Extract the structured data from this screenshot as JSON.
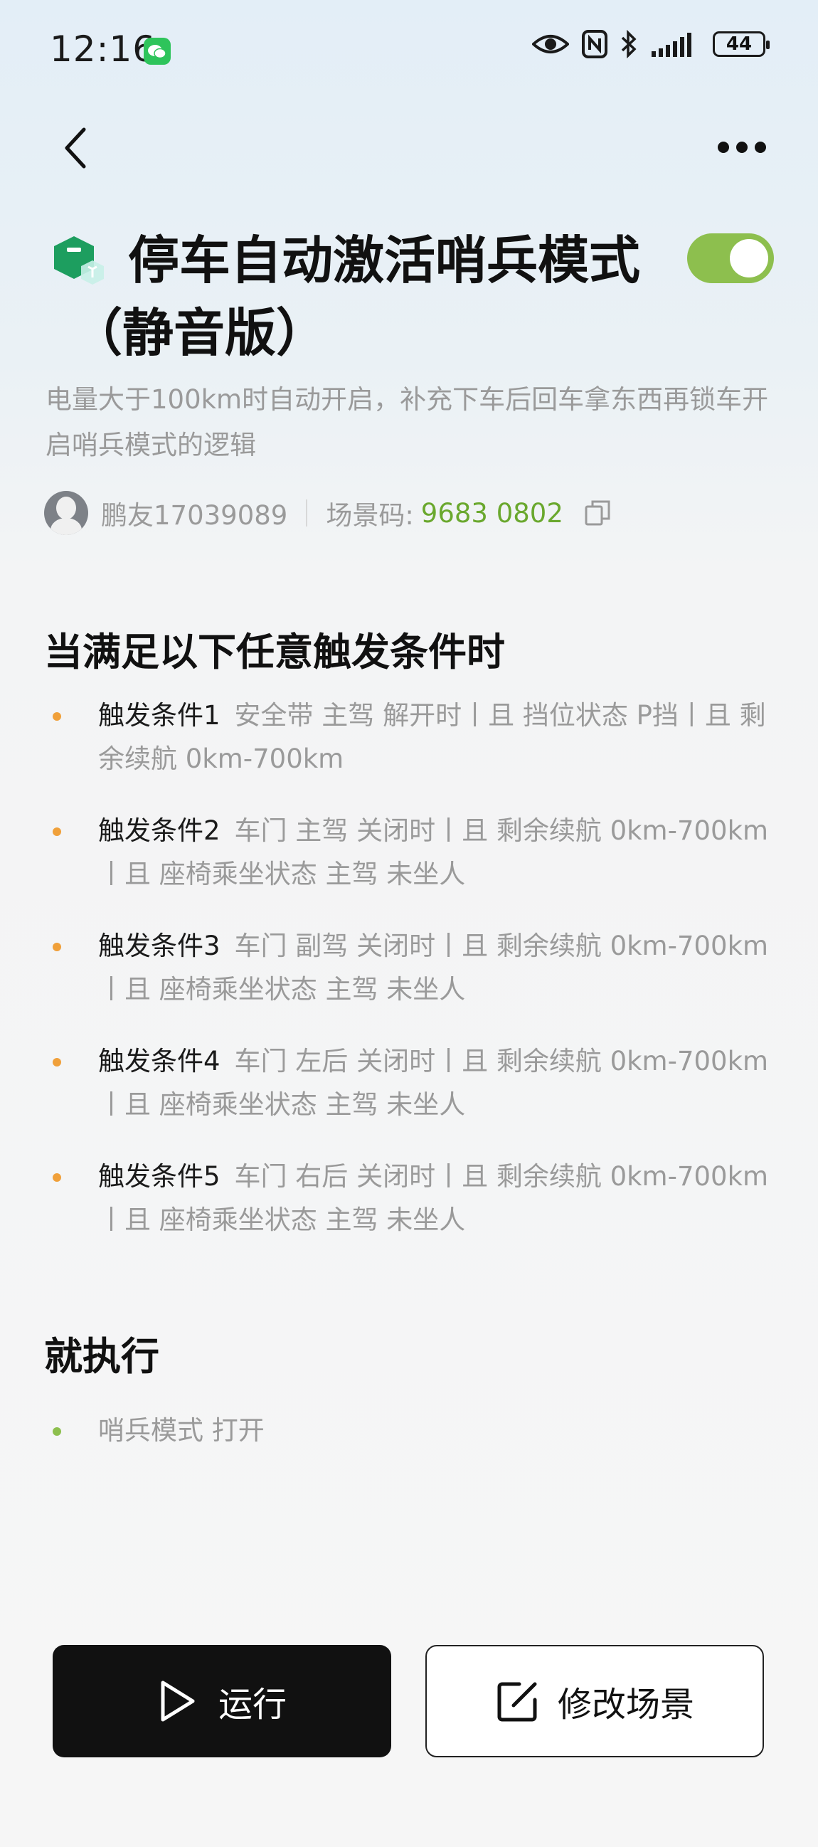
{
  "status_bar": {
    "time": "12:16",
    "battery": "44"
  },
  "scene": {
    "title": "停车自动激活哨兵模式（静音版）",
    "enabled": true,
    "description": "电量大于100km时自动开启，补充下车后回车拿东西再锁车开启哨兵模式的逻辑",
    "author": "鹏友17039089",
    "code_label": "场景码:",
    "code_value": "9683 0802"
  },
  "triggers": {
    "heading": "当满足以下任意触发条件时",
    "items": [
      {
        "label": "触发条件1",
        "text": "安全带 主驾 解开时丨且 挡位状态 P挡丨且 剩余续航 0km-700km"
      },
      {
        "label": "触发条件2",
        "text": "车门 主驾 关闭时丨且 剩余续航 0km-700km丨且 座椅乘坐状态 主驾 未坐人"
      },
      {
        "label": "触发条件3",
        "text": "车门 副驾 关闭时丨且 剩余续航 0km-700km丨且 座椅乘坐状态 主驾 未坐人"
      },
      {
        "label": "触发条件4",
        "text": "车门 左后 关闭时丨且 剩余续航 0km-700km丨且 座椅乘坐状态 主驾 未坐人"
      },
      {
        "label": "触发条件5",
        "text": "车门 右后 关闭时丨且 剩余续航 0km-700km丨且 座椅乘坐状态 主驾 未坐人"
      }
    ]
  },
  "actions": {
    "heading": "就执行",
    "items": [
      {
        "text": "哨兵模式 打开"
      }
    ]
  },
  "buttons": {
    "run_label": "运行",
    "edit_label": "修改场景"
  },
  "colors": {
    "accent_green": "#8dbf4e",
    "code_green": "#6aa82e",
    "trigger_bullet": "#f0a03a"
  }
}
